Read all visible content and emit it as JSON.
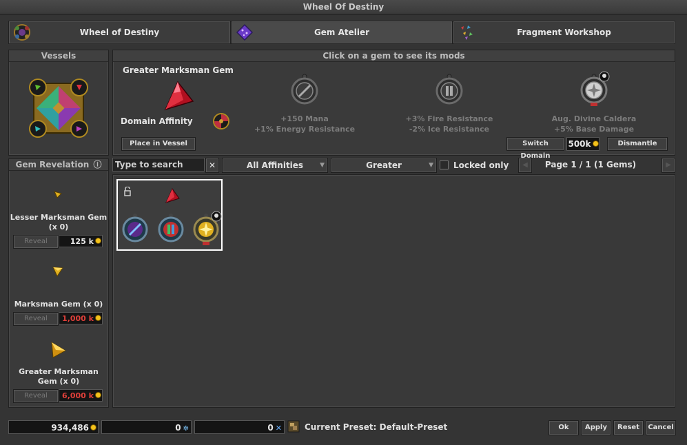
{
  "window": {
    "title": "Wheel Of Destiny"
  },
  "tabs": [
    {
      "label": "Wheel of Destiny",
      "icon": "wheel-icon"
    },
    {
      "label": "Gem Atelier",
      "icon": "gem-atelier-icon",
      "active": true
    },
    {
      "label": "Fragment Workshop",
      "icon": "fragment-icon"
    }
  ],
  "vessels": {
    "title": "Vessels"
  },
  "gem_panel": {
    "hint": "Click on a gem to see its mods",
    "gem_name": "Greater Marksman Gem",
    "domain_label": "Domain Affinity",
    "place_button": "Place in Vessel",
    "mods": [
      {
        "line1": "+150 Mana",
        "line2": "+1% Energy Resistance"
      },
      {
        "line1": "+3% Fire Resistance",
        "line2": "-2% Ice Resistance"
      },
      {
        "line1": "Aug. Divine Caldera",
        "line2": "+5% Base Damage"
      }
    ],
    "switch_domain": "Switch Domain",
    "switch_cost": "500k",
    "dismantle": "Dismantle"
  },
  "revelation": {
    "title": "Gem Revelation",
    "info_icon": "ⓘ",
    "gems": [
      {
        "name": "Lesser Marksman Gem (x 0)",
        "reveal": "Reveal",
        "cost": "125 k",
        "affordable": true
      },
      {
        "name": "Marksman Gem (x 0)",
        "reveal": "Reveal",
        "cost": "1,000 k",
        "affordable": false
      },
      {
        "name": "Greater Marksman Gem (x 0)",
        "reveal": "Reveal",
        "cost": "6,000 k",
        "affordable": false
      }
    ]
  },
  "filters": {
    "search_placeholder": "Type to search",
    "clear": "✕",
    "affinity": "All Affinities",
    "grade": "Greater",
    "locked_only": "Locked only",
    "page": "Page 1 / 1 (1 Gems)"
  },
  "footer": {
    "gold": "934,486",
    "dust": "0",
    "slivers": "0",
    "preset": "Current Preset: Default-Preset",
    "ok": "Ok",
    "apply": "Apply",
    "reset": "Reset",
    "cancel": "Cancel"
  },
  "colors": {
    "accent_red": "#e0403a",
    "gold": "#f3c21c",
    "selected_border": "#ffffff"
  }
}
